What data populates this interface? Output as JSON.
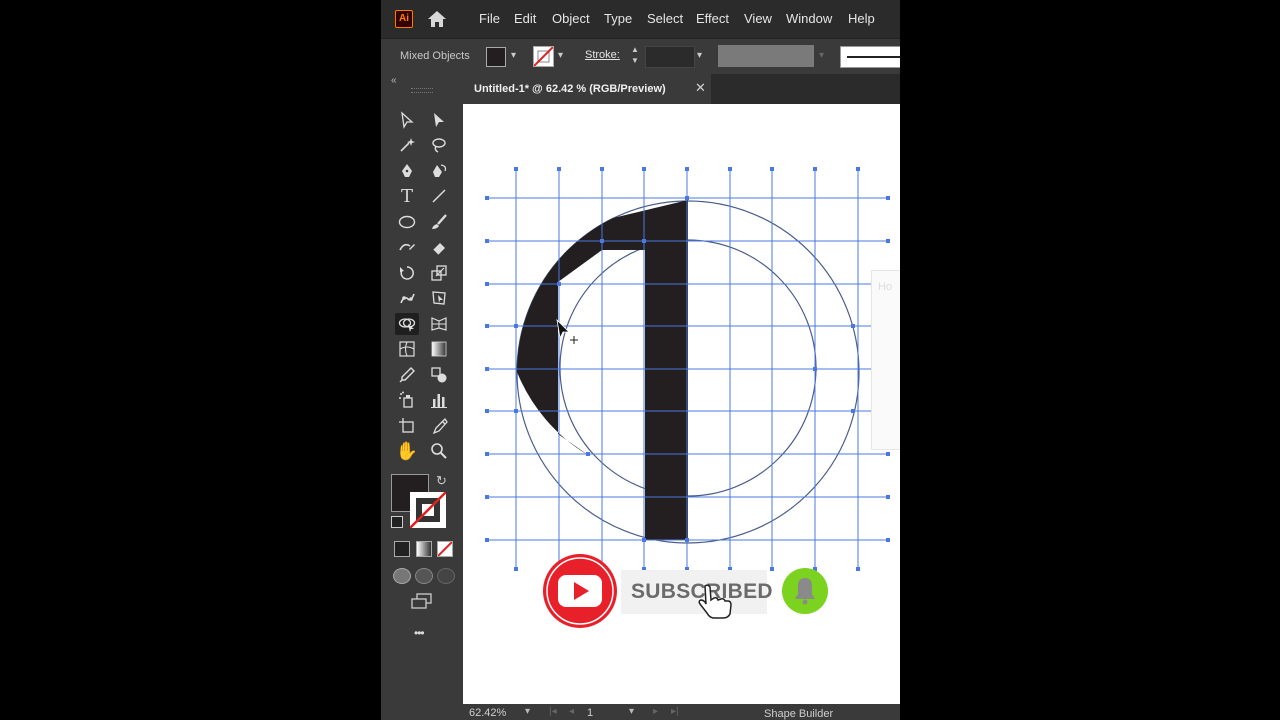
{
  "app": {
    "logo_text": "Ai",
    "brand_color": "#ff7c00"
  },
  "menu": {
    "items": [
      "File",
      "Edit",
      "Object",
      "Type",
      "Select",
      "Effect",
      "View",
      "Window",
      "Help"
    ]
  },
  "control_bar": {
    "selection_label": "Mixed Objects",
    "stroke_label": "Stroke:",
    "fill_color": "#231f20"
  },
  "toolbar": {
    "tools": [
      "selection-tool",
      "direct-selection-tool",
      "magic-wand-tool",
      "lasso-tool",
      "pen-tool",
      "curvature-tool",
      "type-tool",
      "line-segment-tool",
      "ellipse-tool",
      "paintbrush-tool",
      "shaper-tool",
      "eraser-tool",
      "rotate-tool",
      "scale-tool",
      "puppet-warp-tool",
      "free-transform-tool",
      "shape-builder-tool",
      "perspective-grid-tool",
      "mesh-tool",
      "gradient-tool",
      "eyedropper-tool",
      "blend-tool",
      "symbol-sprayer-tool",
      "column-graph-tool",
      "artboard-tool",
      "slice-tool",
      "hand-tool",
      "zoom-tool"
    ],
    "active_tool": "shape-builder-tool",
    "more_label": "•••"
  },
  "document": {
    "tab_title": "Untitled-1* @ 62.42 % (RGB/Preview)",
    "close_glyph": "✕"
  },
  "canvas": {
    "grid_color": "#4a78e0",
    "shape_color": "#231f20"
  },
  "overlay": {
    "subscribe_text": "SUBSCRIBED",
    "youtube_color": "#e8202a",
    "bell_color": "#7bd21f",
    "hover_panel_text": "Ho"
  },
  "status_bar": {
    "zoom": "62.42%",
    "artboard_number": "1",
    "current_tool": "Shape Builder"
  }
}
